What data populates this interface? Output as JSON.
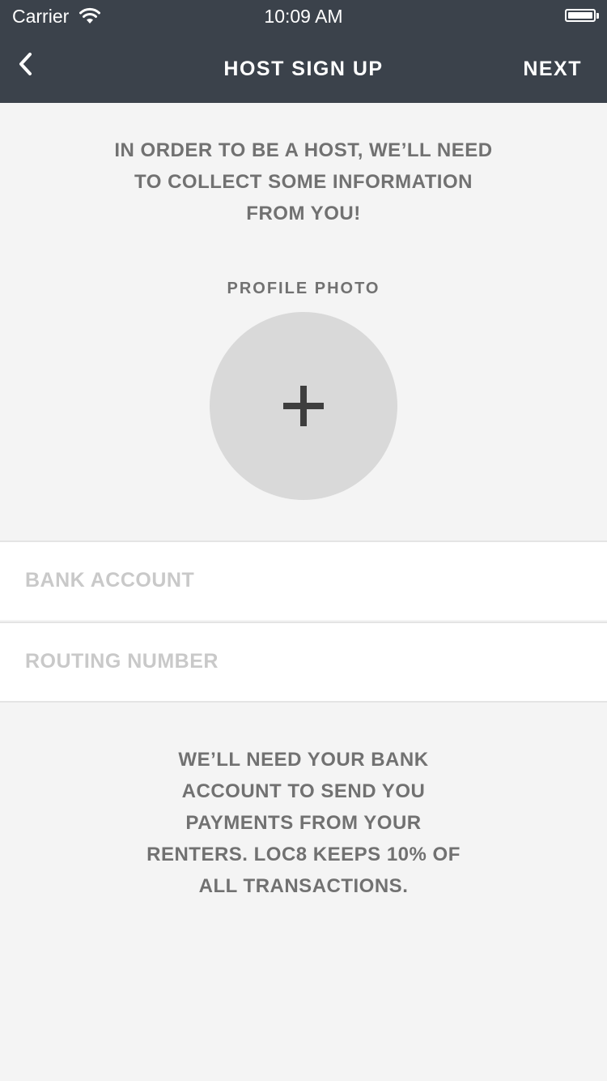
{
  "status_bar": {
    "carrier": "Carrier",
    "time": "10:09 AM",
    "wifi_icon": "wifi-icon",
    "battery_icon": "battery-icon"
  },
  "nav": {
    "back_icon": "chevron-left-icon",
    "title": "HOST SIGN UP",
    "next_label": "NEXT"
  },
  "intro": {
    "text": "IN ORDER TO BE A HOST, WE’LL NEED TO COLLECT SOME INFORMATION FROM YOU!"
  },
  "profile_photo": {
    "label": "PROFILE PHOTO",
    "add_icon": "plus-icon"
  },
  "form": {
    "bank_account": {
      "placeholder": "BANK ACCOUNT",
      "value": ""
    },
    "routing_number": {
      "placeholder": "ROUTING NUMBER",
      "value": ""
    }
  },
  "footer": {
    "text": "WE’LL NEED YOUR BANK ACCOUNT TO SEND YOU PAYMENTS FROM YOUR RENTERS. LOC8 KEEPS 10% OF ALL TRANSACTIONS."
  },
  "colors": {
    "nav_background": "#3b424b",
    "page_background": "#f4f4f4",
    "text_gray": "#717171",
    "placeholder_gray": "#c9c9c9",
    "photo_circle": "#d9d9d9"
  }
}
